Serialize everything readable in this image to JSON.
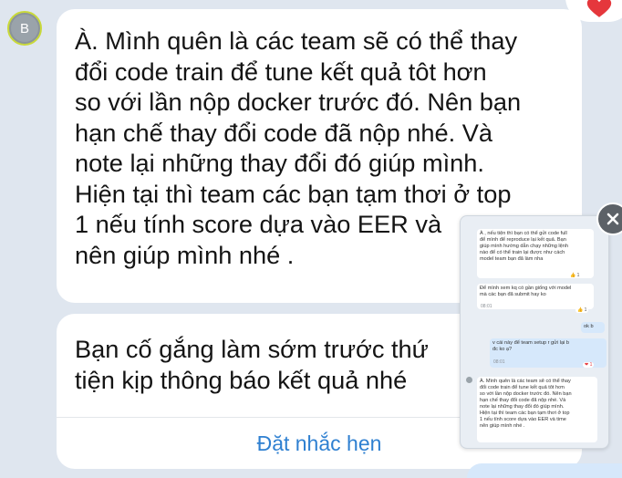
{
  "avatar": {
    "initial": "B"
  },
  "reaction": {
    "icon": "heart-icon",
    "color": "#e5373c"
  },
  "message": {
    "text": "À. Mình quên là các team sẽ có thể thay\nđổi code train để tune kết quả tôt hơn\nso với lần nộp docker trước đó. Nên bạn\nhạn chế thay đổi code đã nộp nhé. Và\nnote lại những thay đổi đó giúp mình.\nHiện tại thì team các bạn tạm thơi ở top\n1 nếu tính score dựa vào EER và\nnên giúp mình nhé ."
  },
  "reminder": {
    "text": "Bạn cố gắng làm sớm trước thứ\ntiện kịp thông báo kết quả nhé",
    "action_label": "Đặt nhắc hẹn"
  },
  "thumbnail": {
    "close_icon": "close-icon",
    "cards": [
      {
        "text": "À , nếu tiện thì bạn có thể gửi code full\nđể mình để reproduce lại kết quả. Bạn\ngiúp mình hướng dẫn chạy những lệnh\nnào để có thể train lại được như cách\nmodel team bạn đã làm nha",
        "reaction": "👍 1"
      },
      {
        "text": "Để mình xem kq có gần giống với model\nmà các bạn đã submit hay ko",
        "time": "08:01",
        "reaction": "👍 1"
      },
      {
        "text": "ok b"
      },
      {
        "text": "v cái này để team setup r gửi lại b\nđc ko ạ?",
        "time": "08:01",
        "reaction": "❤ 1"
      },
      {
        "text": "À. Mình quên là các team sẽ có thể thay\nđổi code train để tune kết quả tôt hơn\nso với lần nộp docker trước đó. Nên bạn\nhạn chế thay đổi code đã nộp nhé. Và\nnote lại những thay đổi đó giúp mình.\nHiện tại thì team các bạn tạm thơi ở top\n1 nếu tính score dựa vào EER và time\nnên giúp mình nhé ."
      }
    ]
  }
}
